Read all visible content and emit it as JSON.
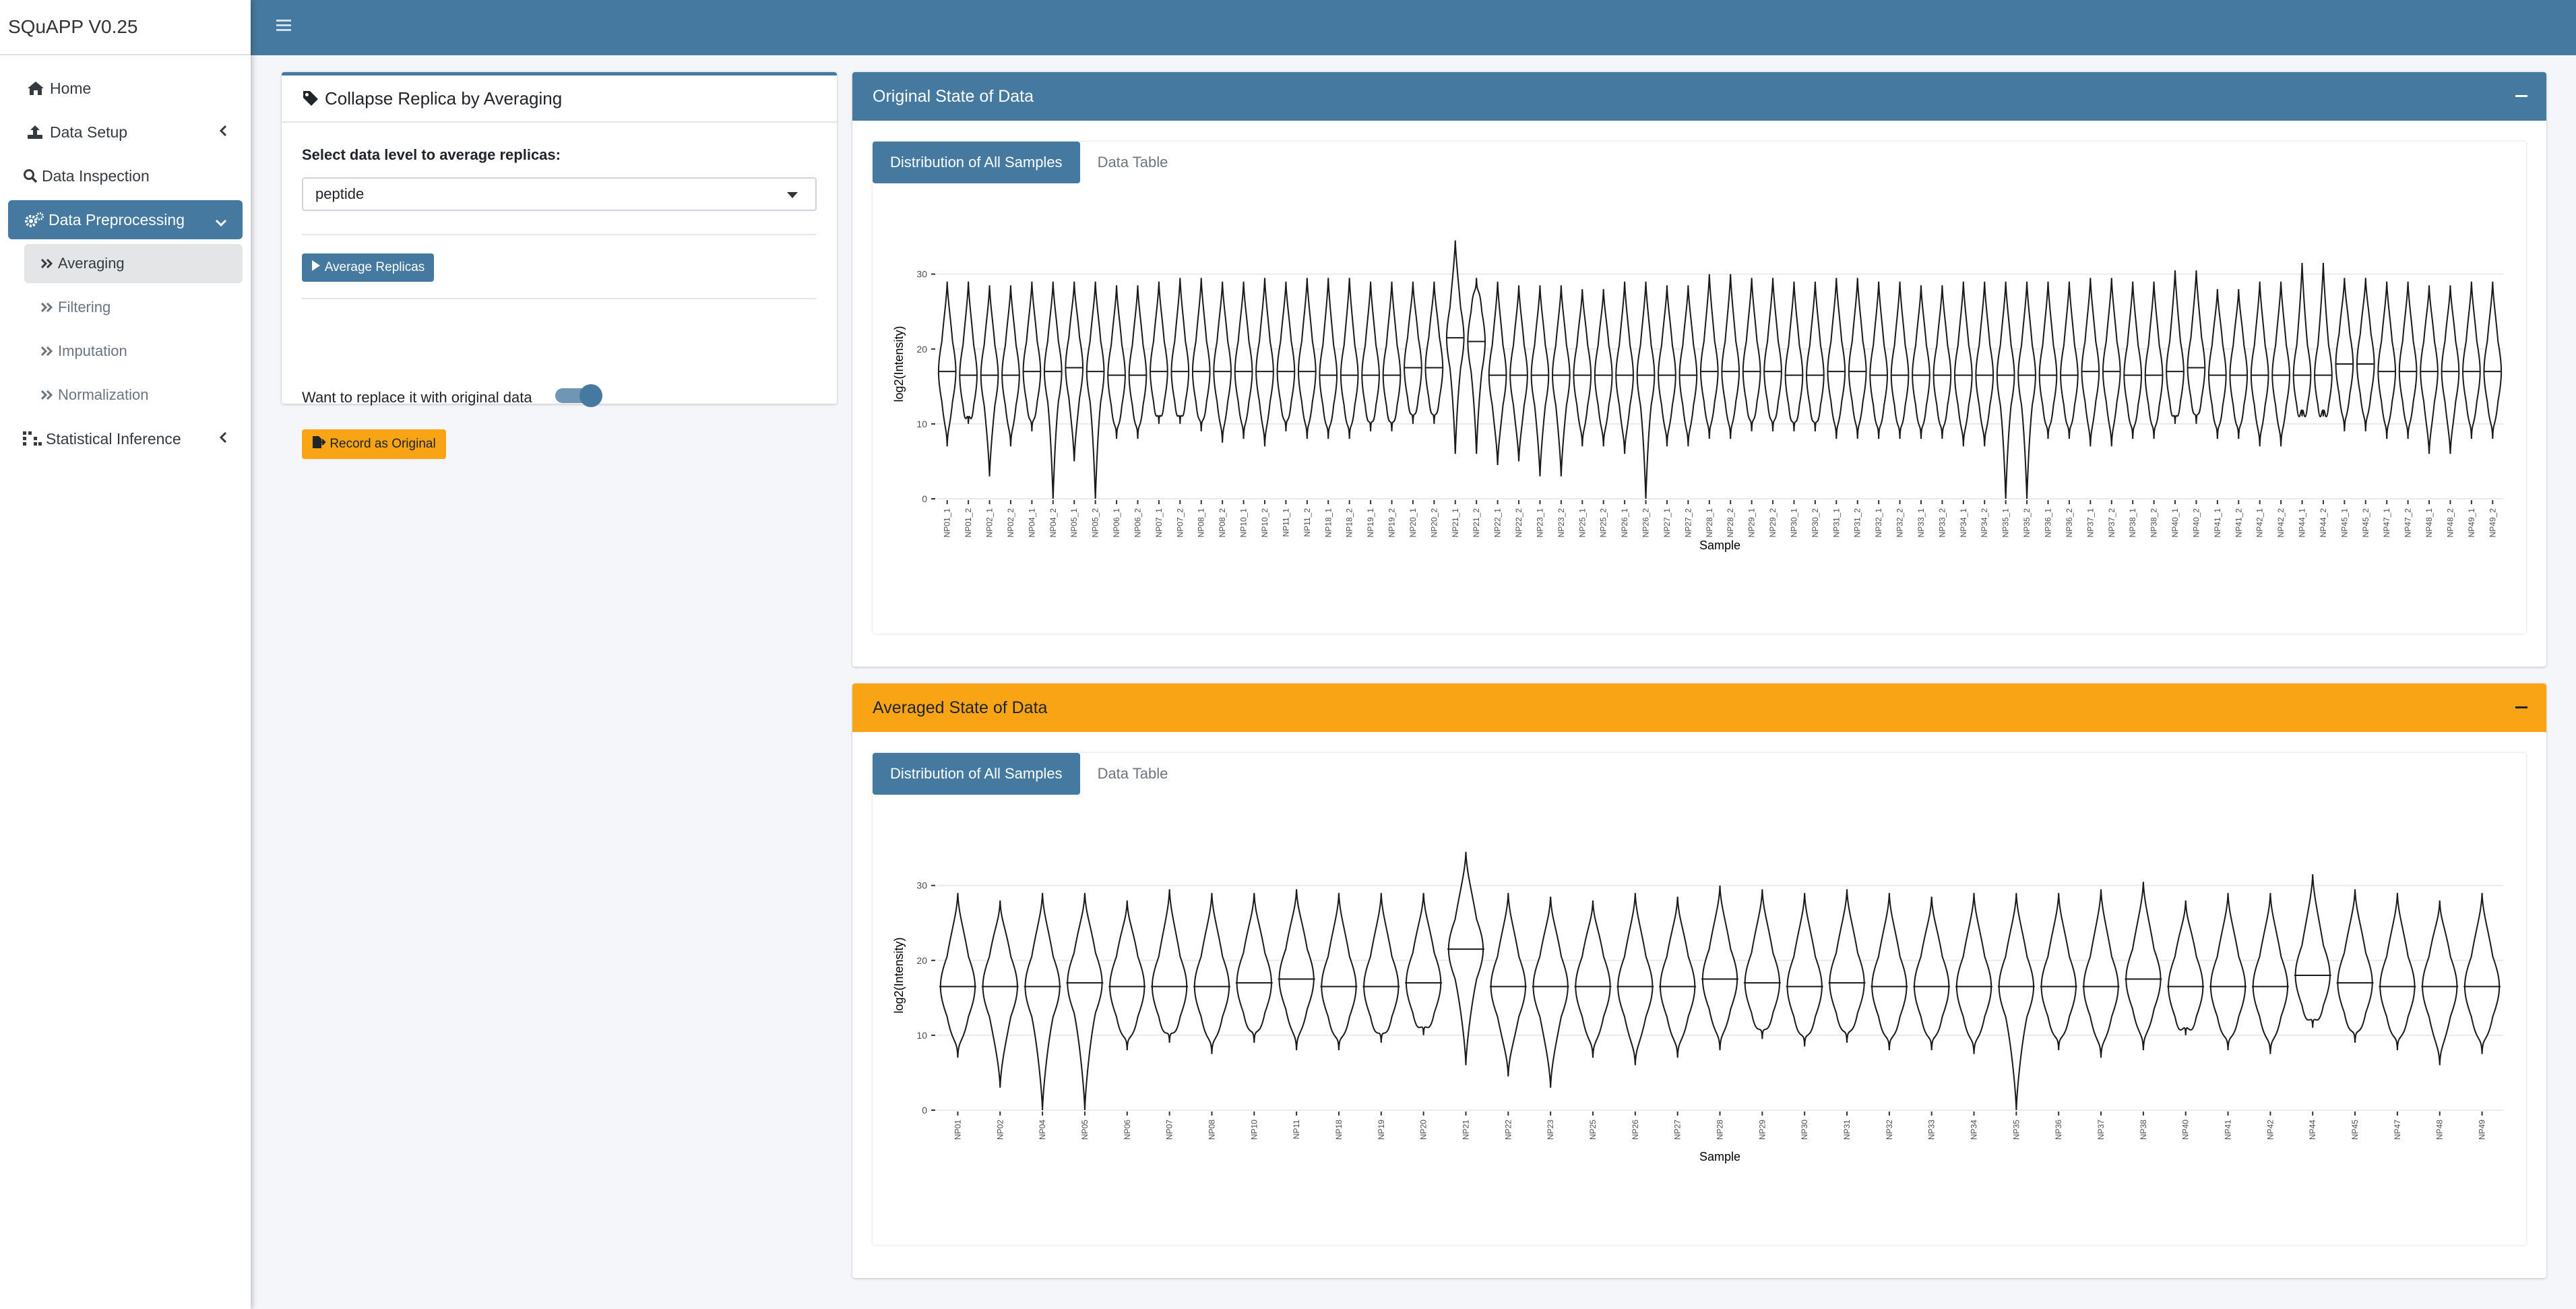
{
  "app": {
    "title": "SQuAPP V0.25"
  },
  "sidebar": {
    "items": [
      {
        "label": "Home",
        "icon": "home-icon"
      },
      {
        "label": "Data Setup",
        "icon": "upload-icon"
      },
      {
        "label": "Data Inspection",
        "icon": "search-icon"
      },
      {
        "label": "Data Preprocessing",
        "icon": "cogs-icon"
      },
      {
        "label": "Statistical Inference",
        "icon": "grid-icon"
      }
    ],
    "subitems": [
      {
        "label": "Averaging"
      },
      {
        "label": "Filtering"
      },
      {
        "label": "Imputation"
      },
      {
        "label": "Normalization"
      }
    ]
  },
  "colors": {
    "primary": "#45799f",
    "warning": "#f8a415",
    "background": "#f4f6f9"
  },
  "panel": {
    "title": "Collapse Replica by Averaging",
    "select_label": "Select data level to average replicas:",
    "select_value": "peptide",
    "average_button": "Average Replicas",
    "switch_label": "Want to replace it with original data",
    "switch_on": true,
    "record_button": "Record as Original"
  },
  "original": {
    "title": "Original State of Data",
    "tabs": [
      "Distribution of All Samples",
      "Data Table"
    ]
  },
  "averaged": {
    "title": "Averaged State of Data",
    "tabs": [
      "Distribution of All Samples",
      "Data Table"
    ]
  },
  "chart_data": [
    {
      "type": "violin",
      "xlabel": "Sample",
      "ylabel": "log2(Intensity)",
      "ylim": [
        0,
        36
      ],
      "yticks": [
        0,
        10,
        20,
        30
      ],
      "categories": [
        "NP01_1",
        "NP01_2",
        "NP02_1",
        "NP02_2",
        "NP04_1",
        "NP04_2",
        "NP05_1",
        "NP05_2",
        "NP06_1",
        "NP06_2",
        "NP07_1",
        "NP07_2",
        "NP08_1",
        "NP08_2",
        "NP10_1",
        "NP10_2",
        "NP11_1",
        "NP11_2",
        "NP18_1",
        "NP18_2",
        "NP19_1",
        "NP19_2",
        "NP20_1",
        "NP20_2",
        "NP21_1",
        "NP21_2",
        "NP22_1",
        "NP22_2",
        "NP23_1",
        "NP23_2",
        "NP25_1",
        "NP25_2",
        "NP26_1",
        "NP26_2",
        "NP27_1",
        "NP27_2",
        "NP28_1",
        "NP28_2",
        "NP29_1",
        "NP29_2",
        "NP30_1",
        "NP30_2",
        "NP31_1",
        "NP31_2",
        "NP32_1",
        "NP32_2",
        "NP33_1",
        "NP33_2",
        "NP34_1",
        "NP34_2",
        "NP35_1",
        "NP35_2",
        "NP36_1",
        "NP36_2",
        "NP37_1",
        "NP37_2",
        "NP38_1",
        "NP38_2",
        "NP40_1",
        "NP40_2",
        "NP41_1",
        "NP41_2",
        "NP42_1",
        "NP42_2",
        "NP44_1",
        "NP44_2",
        "NP45_1",
        "NP45_2",
        "NP47_1",
        "NP47_2",
        "NP48_1",
        "NP48_2",
        "NP49_1",
        "NP49_2"
      ],
      "series": [
        {
          "name": "median",
          "values": [
            17,
            16.5,
            16.5,
            16.5,
            17,
            17,
            17.5,
            17,
            16.5,
            16.5,
            17,
            17,
            17,
            17,
            17,
            17,
            17,
            17,
            16.5,
            16.5,
            16.5,
            16.5,
            17.5,
            17.5,
            21.5,
            21,
            16.5,
            16.5,
            16.5,
            16.5,
            16.5,
            16.5,
            16.5,
            16.5,
            16.5,
            16.5,
            17,
            17,
            17,
            17,
            16.5,
            16.5,
            17,
            17,
            16.5,
            16.5,
            16.5,
            16.5,
            16.5,
            16.5,
            16.5,
            16.5,
            16.5,
            16.5,
            17,
            17,
            16.5,
            16.5,
            17,
            17.5,
            16.5,
            16.5,
            16.5,
            16.5,
            16.5,
            16.5,
            18,
            18,
            17,
            17,
            17,
            17,
            17,
            17
          ]
        },
        {
          "name": "max",
          "values": [
            29,
            29,
            28.5,
            28.5,
            29,
            29,
            29,
            29,
            28.5,
            28.5,
            29,
            29.5,
            29.5,
            29,
            29,
            29.5,
            29,
            29.5,
            29.5,
            29.5,
            29,
            29,
            29,
            29,
            34.5,
            29.5,
            29,
            28.5,
            28.5,
            28.5,
            28,
            28,
            29,
            29,
            28.5,
            28.5,
            30,
            30,
            29.5,
            29.5,
            29,
            29,
            29.5,
            29.5,
            29,
            29,
            28.5,
            28.5,
            29,
            29,
            29,
            29,
            29,
            29,
            29.5,
            29.5,
            29,
            29,
            30.5,
            30.5,
            28,
            28,
            29,
            29,
            31.5,
            31.5,
            29.5,
            29.5,
            29,
            29,
            28.5,
            28.5,
            29,
            29
          ]
        },
        {
          "name": "min",
          "values": [
            7,
            10,
            3,
            7,
            9,
            0,
            5,
            0,
            8,
            8,
            10,
            10,
            9,
            7.5,
            8,
            7,
            9,
            8,
            8,
            8,
            9,
            9,
            10,
            10,
            6,
            6,
            4.5,
            5,
            3,
            3,
            7,
            7,
            6,
            0,
            7,
            7,
            8,
            8,
            9,
            9,
            9,
            9,
            8,
            8,
            8,
            8,
            8,
            8,
            7,
            7,
            0,
            0,
            8,
            8,
            7,
            7,
            8,
            8,
            10,
            10,
            8,
            8,
            7,
            7,
            11,
            11,
            9,
            9,
            8,
            8,
            6,
            6,
            8,
            8
          ]
        }
      ]
    },
    {
      "type": "violin",
      "xlabel": "Sample",
      "ylabel": "log2(Intensity)",
      "ylim": [
        0,
        36
      ],
      "yticks": [
        0,
        10,
        20,
        30
      ],
      "categories": [
        "NP01",
        "NP02",
        "NP04",
        "NP05",
        "NP06",
        "NP07",
        "NP08",
        "NP10",
        "NP11",
        "NP18",
        "NP19",
        "NP20",
        "NP21",
        "NP22",
        "NP23",
        "NP25",
        "NP26",
        "NP27",
        "NP28",
        "NP29",
        "NP30",
        "NP31",
        "NP32",
        "NP33",
        "NP34",
        "NP35",
        "NP36",
        "NP37",
        "NP38",
        "NP40",
        "NP41",
        "NP42",
        "NP44",
        "NP45",
        "NP47",
        "NP48",
        "NP49"
      ],
      "series": [
        {
          "name": "median",
          "values": [
            16.5,
            16.5,
            16.5,
            17,
            16.5,
            16.5,
            16.5,
            17,
            17.5,
            16.5,
            16.5,
            17,
            21.5,
            16.5,
            16.5,
            16.5,
            16.5,
            16.5,
            17.5,
            17,
            16.5,
            17,
            16.5,
            16.5,
            16.5,
            16.5,
            16.5,
            16.5,
            17.5,
            16.5,
            16.5,
            16.5,
            18,
            17,
            16.5,
            16.5,
            16.5
          ]
        },
        {
          "name": "max",
          "values": [
            29,
            28,
            29,
            29,
            28,
            29.5,
            29,
            29,
            29.5,
            29,
            29,
            29,
            34.5,
            29,
            28.5,
            28,
            29,
            28.5,
            30,
            29.5,
            29,
            29.5,
            29,
            28.5,
            29,
            29,
            29,
            29.5,
            30.5,
            28,
            29,
            29,
            31.5,
            29.5,
            29,
            28,
            29
          ]
        },
        {
          "name": "min",
          "values": [
            7,
            3,
            0,
            0,
            8,
            9,
            7.5,
            9,
            8,
            8,
            9,
            10,
            6,
            4.5,
            3,
            7,
            6,
            7,
            8,
            9.5,
            8.5,
            9,
            8,
            8,
            7.5,
            0,
            8,
            7,
            8,
            10,
            8,
            7.5,
            11,
            9,
            8,
            6,
            7.5
          ]
        }
      ]
    }
  ]
}
